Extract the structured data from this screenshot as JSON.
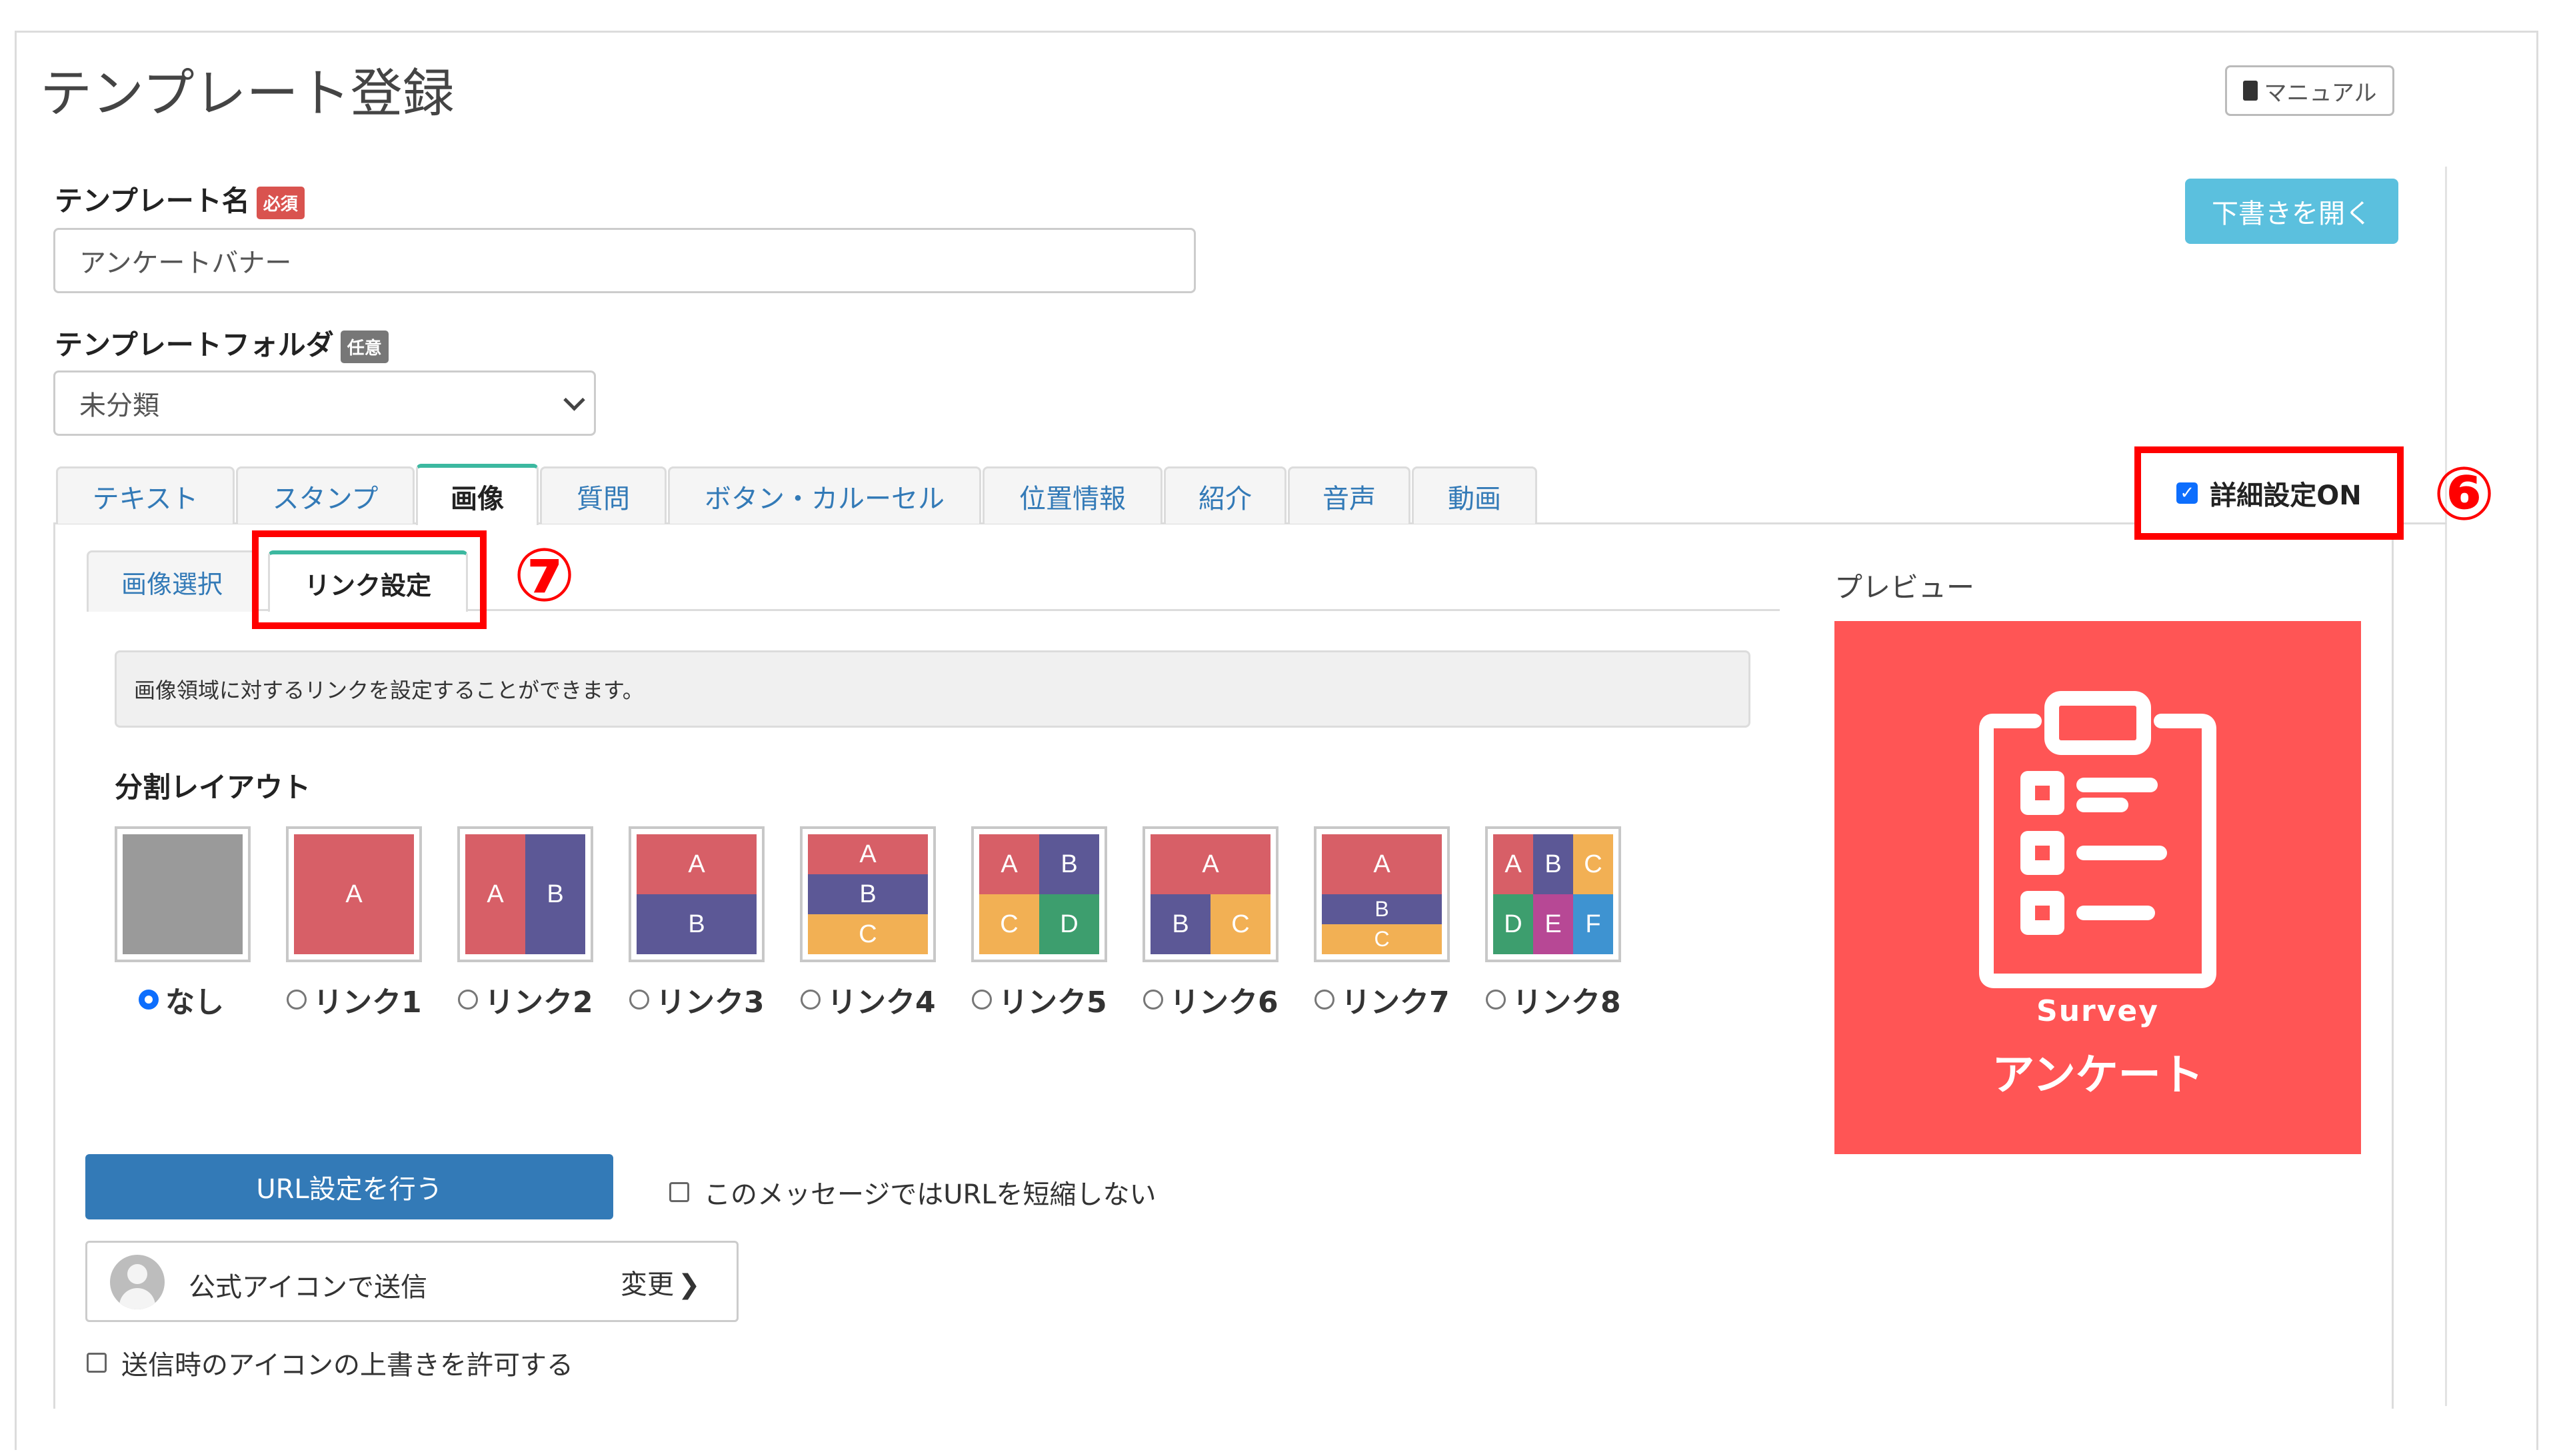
{
  "page": {
    "title": "テンプレート登録",
    "manual_label": "マニュアル",
    "draft_button": "下書きを開く"
  },
  "form": {
    "name_label": "テンプレート名",
    "name_badge": "必須",
    "name_value": "アンケートバナー",
    "folder_label": "テンプレートフォルダ",
    "folder_badge": "任意",
    "folder_value": "未分類"
  },
  "tabs": [
    {
      "label": "テキスト"
    },
    {
      "label": "スタンプ"
    },
    {
      "label": "画像",
      "active": true
    },
    {
      "label": "質問"
    },
    {
      "label": "ボタン・カルーセル"
    },
    {
      "label": "位置情報"
    },
    {
      "label": "紹介"
    },
    {
      "label": "音声"
    },
    {
      "label": "動画"
    }
  ],
  "detail_setting": {
    "label": "詳細設定ON",
    "checked": true,
    "marker": "⑥"
  },
  "subtabs": [
    {
      "label": "画像選択"
    },
    {
      "label": "リンク設定",
      "active": true
    }
  ],
  "subtab_marker": "⑦",
  "info_text": "画像領域に対するリンクを設定することができます。",
  "layout_heading": "分割レイアウト",
  "layouts": [
    {
      "label": "なし",
      "selected": true,
      "cells": []
    },
    {
      "label": "リンク1",
      "cells": [
        "A"
      ]
    },
    {
      "label": "リンク2",
      "cells": [
        "A",
        "B"
      ]
    },
    {
      "label": "リンク3",
      "cells": [
        "A",
        "B"
      ]
    },
    {
      "label": "リンク4",
      "cells": [
        "A",
        "B",
        "C"
      ]
    },
    {
      "label": "リンク5",
      "cells": [
        "A",
        "B",
        "C",
        "D"
      ]
    },
    {
      "label": "リンク6",
      "cells": [
        "A",
        "B",
        "C"
      ]
    },
    {
      "label": "リンク7",
      "cells": [
        "A",
        "B",
        "C"
      ]
    },
    {
      "label": "リンク8",
      "cells": [
        "A",
        "B",
        "C",
        "D",
        "E",
        "F"
      ]
    }
  ],
  "preview": {
    "label": "プレビュー",
    "image_caption": "Survey",
    "image_title": "アンケート",
    "bg_color": "#ff5555"
  },
  "url_button": "URL設定を行う",
  "no_shorten_label": "このメッセージではURLを短縮しない",
  "sender": {
    "label": "公式アイコンで送信",
    "change": "変更"
  },
  "allow_override_label": "送信時のアイコンの上書きを許可する",
  "colors": {
    "accent_blue": "#337ab7",
    "info_blue": "#5bc0de",
    "required_red": "#d9534f",
    "highlight_red": "#ff0000",
    "tab_green": "#3cb8a0"
  }
}
